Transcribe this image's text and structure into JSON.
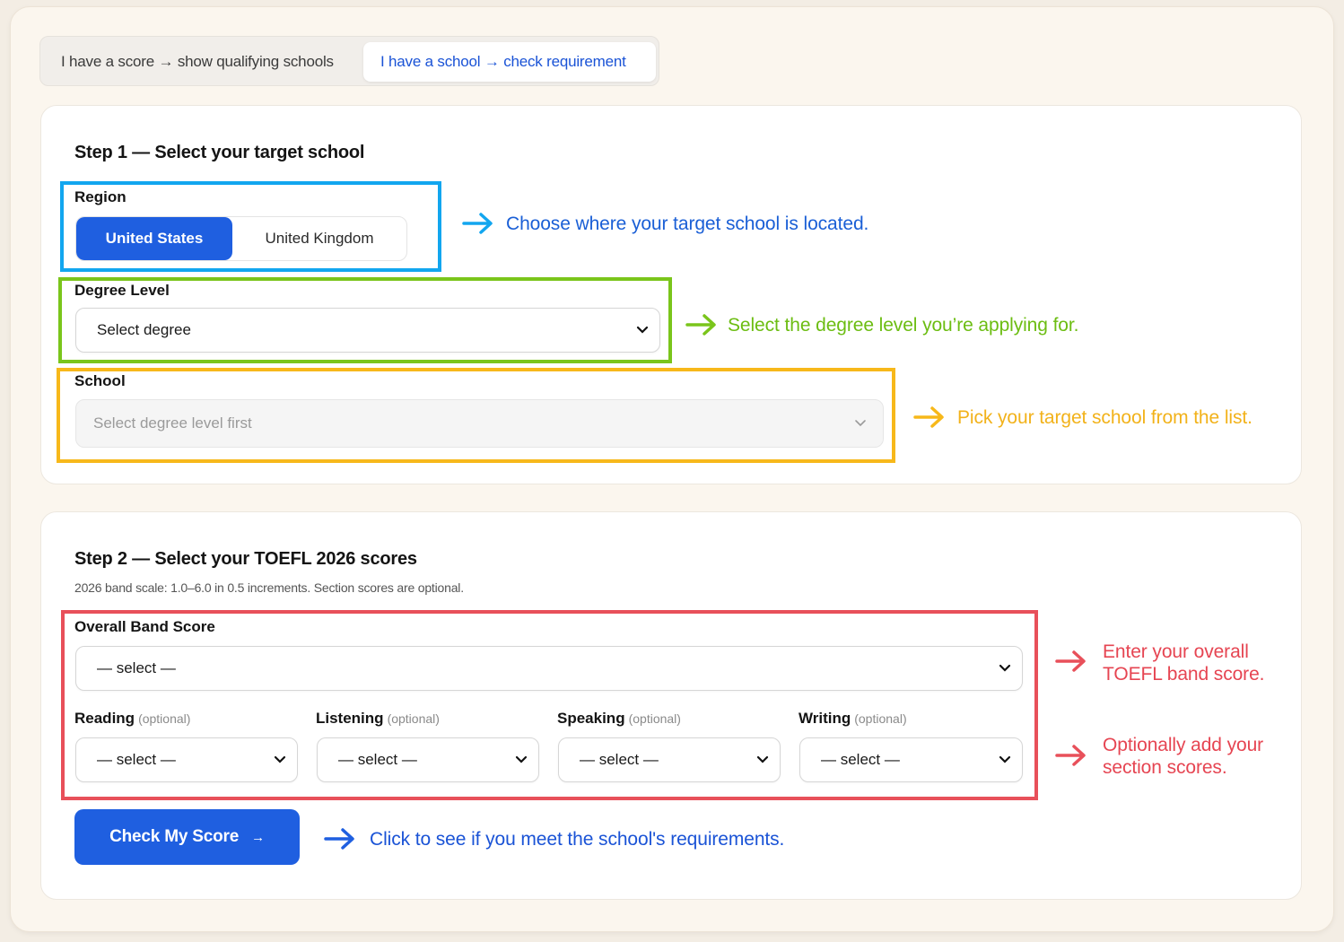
{
  "mode_toggle": {
    "option_score": "I have a score → show qualifying schools",
    "option_school": "I have a school → check requirement"
  },
  "step1": {
    "title": "Step 1 — Select your target school",
    "region_label": "Region",
    "region_options": [
      "United States",
      "United Kingdom"
    ],
    "region_selected": "United States",
    "degree_label": "Degree Level",
    "degree_value": "Select degree",
    "school_label": "School",
    "school_value": "Select degree level first"
  },
  "step2": {
    "title": "Step 2 — Select your TOEFL 2026 scores",
    "subtitle": "2026 band scale: 1.0–6.0 in 0.5 increments. Section scores are optional.",
    "overall_label": "Overall Band Score",
    "overall_value": "— select —",
    "sections": [
      {
        "label": "Reading",
        "optional": "(optional)",
        "value": "— select —"
      },
      {
        "label": "Listening",
        "optional": "(optional)",
        "value": "— select —"
      },
      {
        "label": "Speaking",
        "optional": "(optional)",
        "value": "— select —"
      },
      {
        "label": "Writing",
        "optional": "(optional)",
        "value": "— select —"
      }
    ],
    "cta_label": "Check My Score"
  },
  "annotations": {
    "region": "Choose where your target school is located.",
    "degree": "Select the degree level you’re applying for.",
    "school": "Pick your target school from the list.",
    "overall_line1": "Enter your overall",
    "overall_line2": "TOEFL band score.",
    "sections_line1": "Optionally add your",
    "sections_line2": "section scores.",
    "cta": "Click to see if you meet the school's requirements."
  },
  "colors": {
    "primary": "#1f5fe0",
    "blue_highlight": "#12a6ef",
    "green_highlight": "#7ac51b",
    "yellow_highlight": "#f7b81a",
    "red_highlight": "#e8505a"
  }
}
